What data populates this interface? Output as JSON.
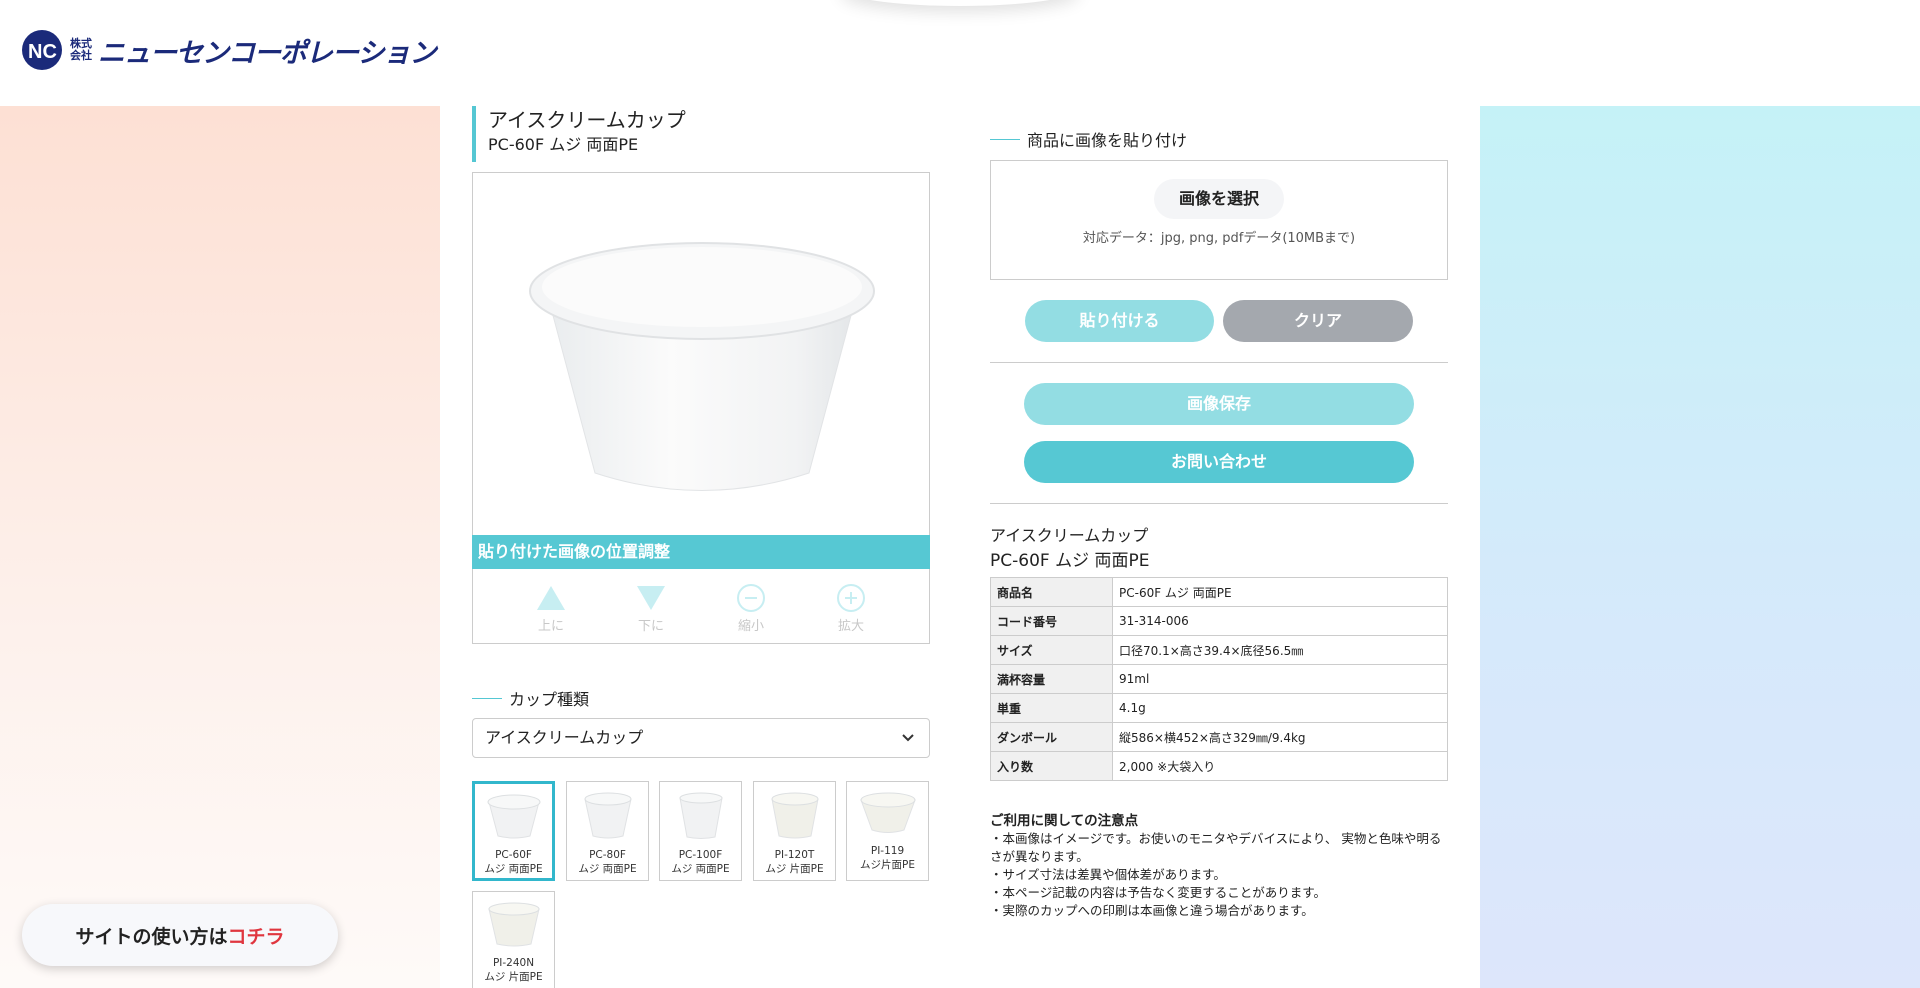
{
  "header": {
    "logo_mark": "NC",
    "logo_small_top": "株式",
    "logo_small_bottom": "会社",
    "logo_name": "ニューセンコーポレーション"
  },
  "help": {
    "text": "サイトの使い方は",
    "link": "コチラ"
  },
  "product": {
    "title": "アイスクリームカップ",
    "subtitle": "PC-60F ムジ 両面PE"
  },
  "adjust": {
    "title": "貼り付けた画像の位置調整",
    "controls": [
      {
        "label": "上に",
        "icon": "triangle-up-icon"
      },
      {
        "label": "下に",
        "icon": "triangle-down-icon"
      },
      {
        "label": "縮小",
        "icon": "minus-circle-icon"
      },
      {
        "label": "拡大",
        "icon": "plus-circle-icon"
      }
    ]
  },
  "cup_type": {
    "label": "カップ種類",
    "selected": "アイスクリームカップ"
  },
  "thumbnails": [
    {
      "line1": "PC-60F",
      "line2": "ムジ 両面PE",
      "active": true
    },
    {
      "line1": "PC-80F",
      "line2": "ムジ 両面PE",
      "active": false
    },
    {
      "line1": "PC-100F",
      "line2": "ムジ 両面PE",
      "active": false
    },
    {
      "line1": "PI-120T",
      "line2": "ムジ 片面PE",
      "active": false
    },
    {
      "line1": "PI-119",
      "line2": "ムジ片面PE",
      "active": false
    },
    {
      "line1": "PI-240N",
      "line2": "ムジ 片面PE",
      "active": false
    }
  ],
  "upload": {
    "label": "商品に画像を貼り付け",
    "choose_button": "画像を選択",
    "note": "対応データ：jpg, png, pdfデータ(10MBまで)"
  },
  "actions": {
    "paste": "貼り付ける",
    "clear": "クリア",
    "save": "画像保存",
    "contact": "お問い合わせ"
  },
  "colors": {
    "accent": "#56c8d3",
    "accent_light": "#93dde3",
    "gray_button": "#a4a8ae",
    "red_link": "#e0363f",
    "logo_navy": "#1b2a7a"
  },
  "info": {
    "title": "アイスクリームカップ",
    "subtitle": "PC-60F ムジ 両面PE",
    "specs": [
      {
        "key": "商品名",
        "value": "PC-60F ムジ 両面PE"
      },
      {
        "key": "コード番号",
        "value": "31-314-006"
      },
      {
        "key": "サイズ",
        "value": "口径70.1×高さ39.4×底径56.5㎜"
      },
      {
        "key": "満杯容量",
        "value": "91ml"
      },
      {
        "key": "単重",
        "value": "4.1g"
      },
      {
        "key": "ダンボール",
        "value": "縦586×横452×高さ329㎜/9.4kg"
      },
      {
        "key": "入り数",
        "value": "2,000 ※大袋入り"
      }
    ]
  },
  "notes": {
    "title": "ご利用に関しての注意点",
    "items": [
      "・本画像はイメージです。お使いのモニタやデバイスにより、 実物と色味や明るさが異なります。",
      "・サイズ寸法は差異や個体差があります。",
      "・本ページ記載の内容は予告なく変更することがあります。",
      "・実際のカップへの印刷は本画像と違う場合があります。"
    ]
  }
}
